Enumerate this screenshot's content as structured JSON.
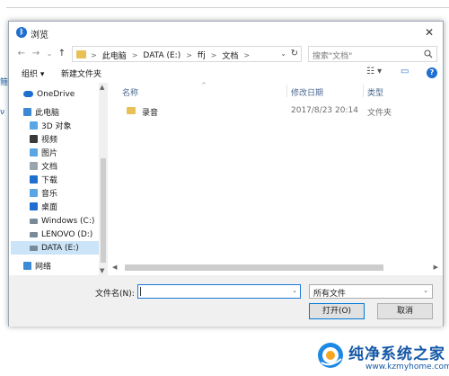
{
  "background": {
    "frag1": "箍",
    "frag2": "ν"
  },
  "dialog": {
    "title": "浏览",
    "close_glyph": "✕"
  },
  "nav": {
    "back": "←",
    "forward": "→",
    "dropdown": "⌄",
    "up": "↑",
    "breadcrumbs": [
      "此电脑",
      "DATA (E:)",
      "ffj",
      "文档"
    ],
    "separator": ">",
    "refresh": "↻",
    "search_placeholder": "搜索\"文档\""
  },
  "toolbar": {
    "organize": "组织 ▾",
    "new_folder": "新建文件夹",
    "view_icon": "☷ ▾",
    "pane_icon": "▭",
    "help": "?"
  },
  "sidebar": {
    "items": [
      {
        "label": "OneDrive",
        "icon": "cloud-icon",
        "color": "#1e6fd0",
        "selected": false
      },
      {
        "label": "此电脑",
        "icon": "computer-icon",
        "color": "#3b8ad6",
        "selected": false
      },
      {
        "label": "3D 对象",
        "icon": "3d-objects-icon",
        "color": "#58a6e6",
        "selected": false
      },
      {
        "label": "视频",
        "icon": "video-icon",
        "color": "#3a3a3a",
        "selected": false
      },
      {
        "label": "图片",
        "icon": "pictures-icon",
        "color": "#58a6e6",
        "selected": false
      },
      {
        "label": "文档",
        "icon": "documents-icon",
        "color": "#9aa4ae",
        "selected": false
      },
      {
        "label": "下载",
        "icon": "downloads-icon",
        "color": "#1e6fd0",
        "selected": false
      },
      {
        "label": "音乐",
        "icon": "music-icon",
        "color": "#58a6e6",
        "selected": false
      },
      {
        "label": "桌面",
        "icon": "desktop-icon",
        "color": "#1e6fd0",
        "selected": false
      },
      {
        "label": "Windows (C:)",
        "icon": "drive-c-icon",
        "color": "#7a8a99",
        "selected": false
      },
      {
        "label": "LENOVO (D:)",
        "icon": "drive-d-icon",
        "color": "#7a8a99",
        "selected": false
      },
      {
        "label": "DATA (E:)",
        "icon": "drive-e-icon",
        "color": "#7a8a99",
        "selected": true
      },
      {
        "label": "网络",
        "icon": "network-icon",
        "color": "#3b8ad6",
        "selected": false
      }
    ]
  },
  "columns": {
    "name": "名称",
    "modified": "修改日期",
    "type": "类型"
  },
  "files": [
    {
      "name": "录音",
      "modified": "2017/8/23 20:14",
      "type": "文件夹"
    }
  ],
  "footer": {
    "filename_label": "文件名(N):",
    "filename_value": "",
    "filter_value": "所有文件",
    "open_label": "打开(O)",
    "cancel_label": "取消"
  },
  "watermark": {
    "name": "纯净系统之家",
    "url": "www.kzmyhome.com"
  }
}
